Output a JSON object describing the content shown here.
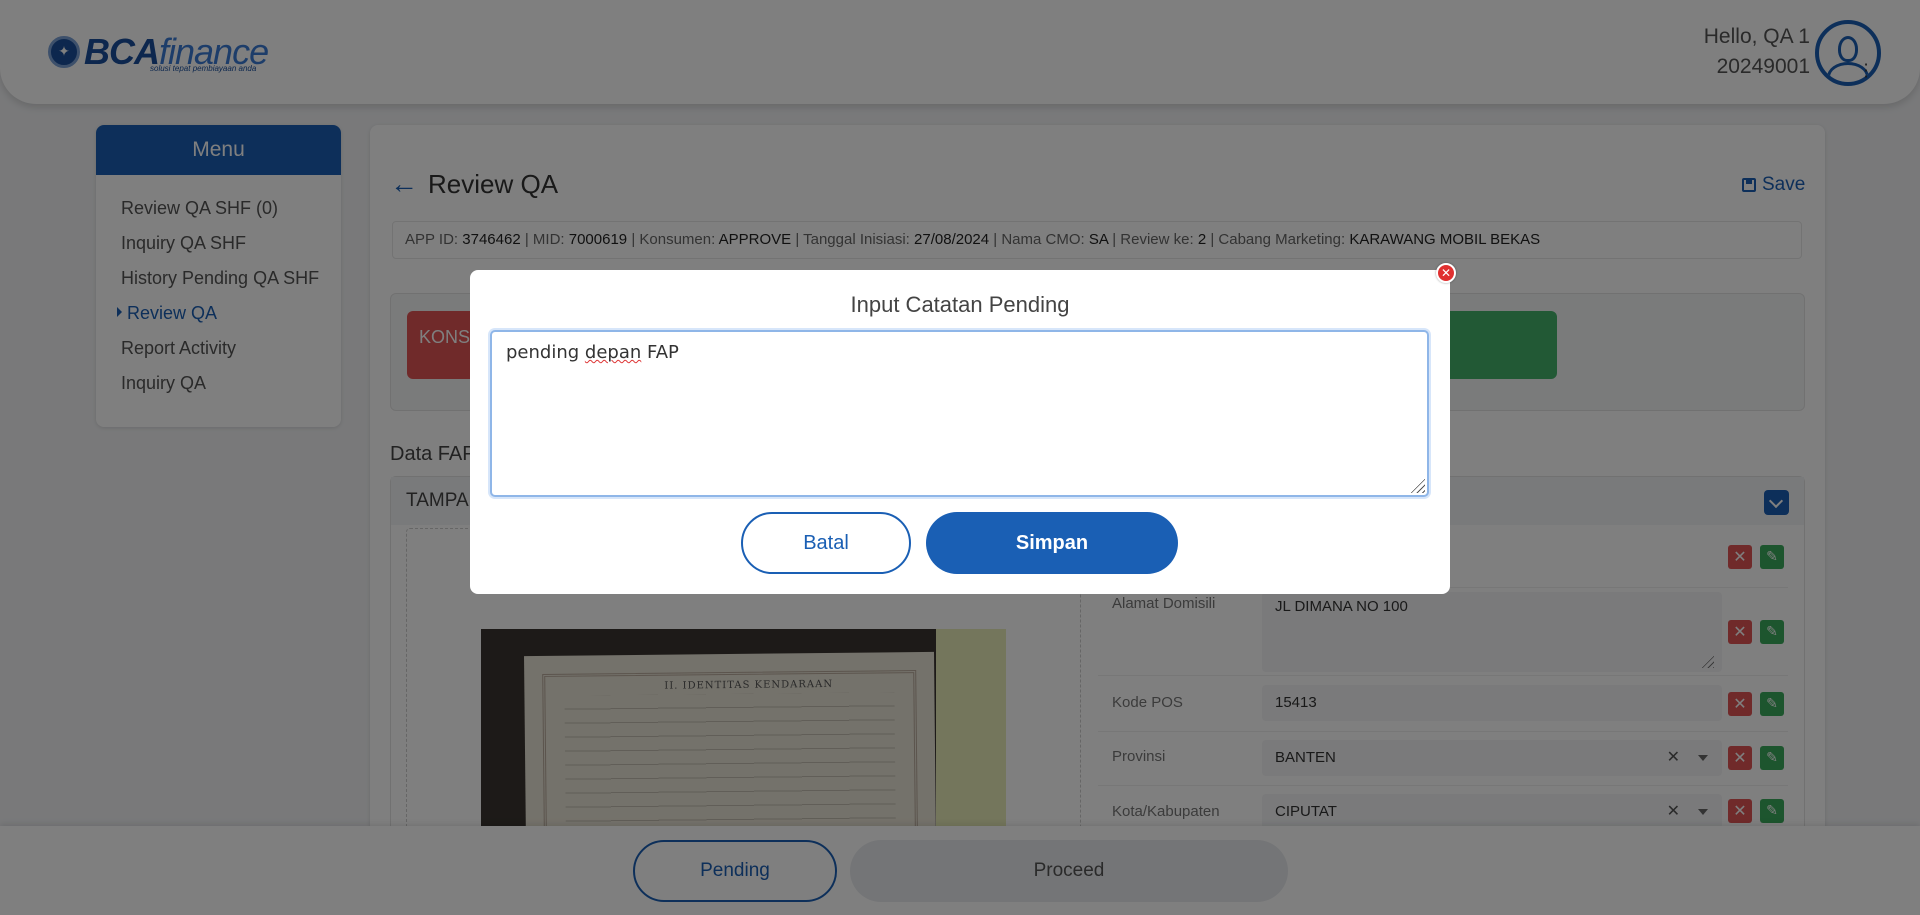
{
  "header": {
    "logo_text_a": "BCA",
    "logo_text_b": "finance",
    "logo_tagline": "solusi tepat pembiayaan anda",
    "greeting": "Hello, QA 1",
    "user_id": "20249001"
  },
  "sidebar": {
    "title": "Menu",
    "items": [
      {
        "label": "Review QA SHF (0)",
        "active": false
      },
      {
        "label": "Inquiry QA SHF",
        "active": false
      },
      {
        "label": "History Pending QA SHF",
        "active": false
      },
      {
        "label": "Review QA",
        "active": true
      },
      {
        "label": "Report Activity",
        "active": false
      },
      {
        "label": "Inquiry QA",
        "active": false
      }
    ]
  },
  "main": {
    "title": "Review QA",
    "save_label": "Save",
    "info": {
      "app_id_label": "APP ID:",
      "app_id": "3746462",
      "mid_label": "MID:",
      "mid": "7000619",
      "konsumen_label": "Konsumen:",
      "konsumen": "APPROVE",
      "tanggal_label": "Tanggal Inisiasi:",
      "tanggal": "27/08/2024",
      "cmo_label": "Nama CMO:",
      "cmo": "SA",
      "review_label": "Review ke:",
      "review": "2",
      "cabang_label": "Cabang Marketing:",
      "cabang": "KARAWANG MOBIL BEKAS"
    },
    "konsumen_badge": "KONS",
    "section_title": "Data FAP",
    "panel_title": "TAMPAK",
    "document": {
      "heading": "II. IDENTITAS KENDARAAN"
    },
    "form": [
      {
        "label": "Alamat Domisili",
        "value": "JL DIMANA NO 100"
      },
      {
        "label": "Kode POS",
        "value": "15413"
      },
      {
        "label": "Provinsi",
        "value": "BANTEN"
      },
      {
        "label": "Kota/Kabupaten",
        "value": "CIPUTAT"
      }
    ]
  },
  "footer": {
    "pending_label": "Pending",
    "proceed_label": "Proceed"
  },
  "modal": {
    "title": "Input Catatan Pending",
    "note_word1": "pending ",
    "note_word2": "depan",
    "note_word3": " FAP",
    "cancel_label": "Batal",
    "submit_label": "Simpan"
  },
  "colors": {
    "brand_blue": "#1a5fb4",
    "danger_red": "#e05555",
    "success_green": "#3aaa5c"
  }
}
